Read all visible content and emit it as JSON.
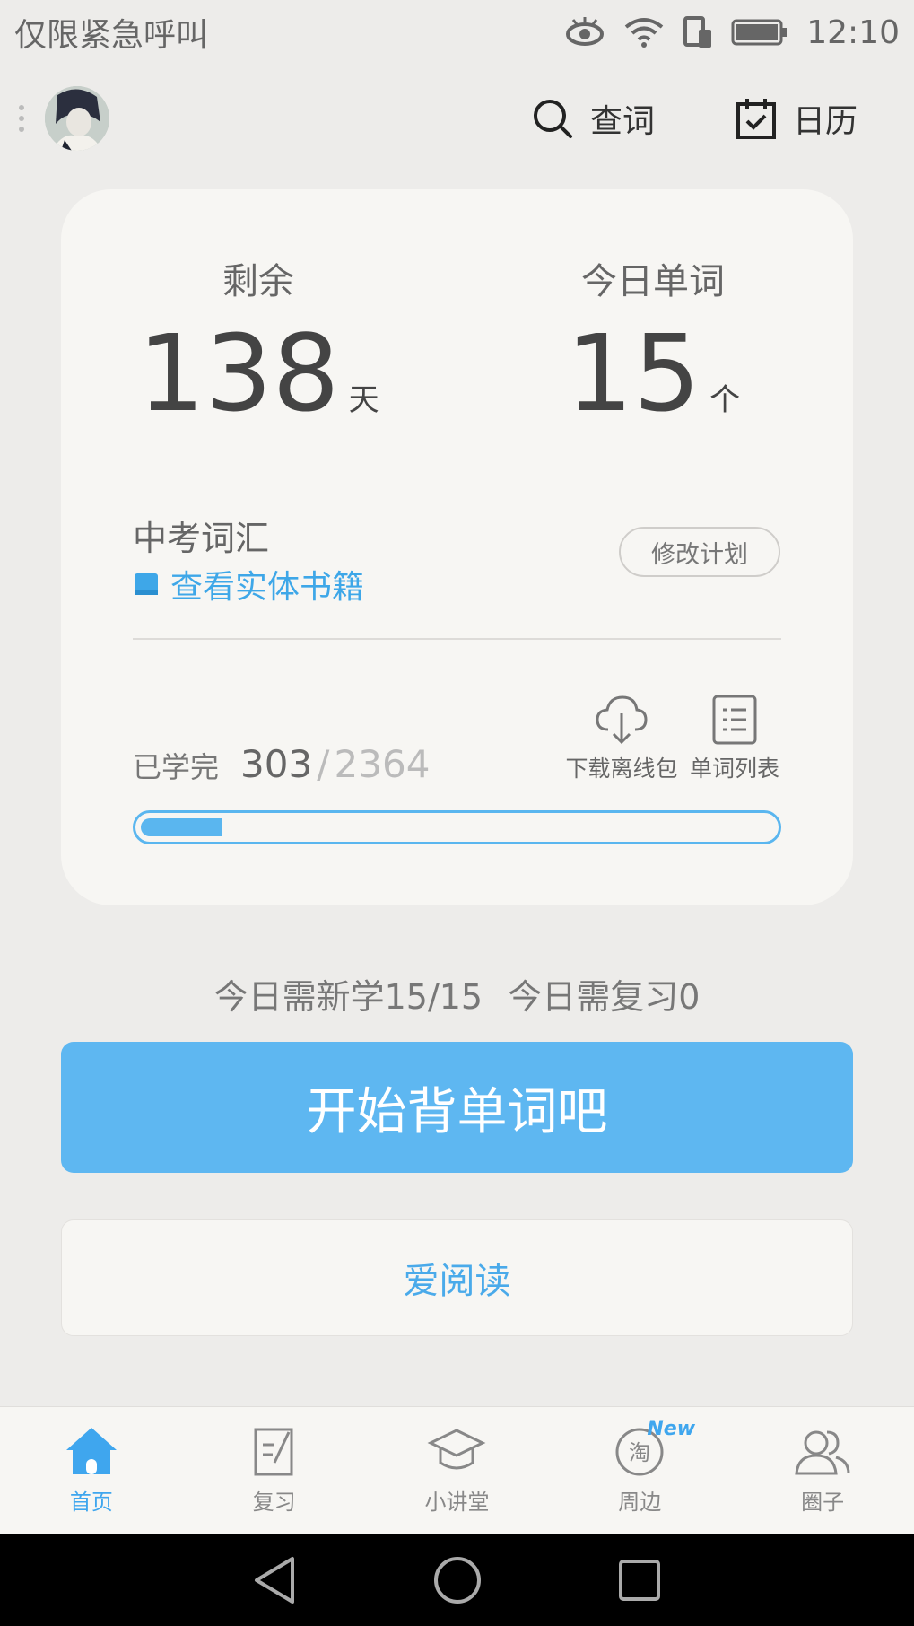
{
  "status_bar": {
    "carrier_text": "仅限紧急呼叫",
    "time": "12:10"
  },
  "header": {
    "search_label": "查词",
    "calendar_label": "日历"
  },
  "plan_card": {
    "remaining_label": "剩余",
    "remaining_value": "138",
    "remaining_unit": "天",
    "today_words_label": "今日单词",
    "today_words_value": "15",
    "today_words_unit": "个",
    "book_title": "中考词汇",
    "view_book_label": "查看实体书籍",
    "modify_plan_label": "修改计划",
    "learned_label": "已学完",
    "learned_count": "303",
    "separator": "/",
    "total_count": "2364",
    "download_label": "下载离线包",
    "word_list_label": "单词列表",
    "progress_fraction": 0.128
  },
  "today_summary": {
    "new_text": "今日需新学15/15",
    "review_text": "今日需复习0"
  },
  "buttons": {
    "start_label": "开始背单词吧",
    "read_label": "爱阅读"
  },
  "bottom_nav": {
    "items": [
      {
        "label": "首页",
        "icon": "home-icon",
        "active": true
      },
      {
        "label": "复习",
        "icon": "review-icon",
        "active": false
      },
      {
        "label": "小讲堂",
        "icon": "graduation-cap-icon",
        "active": false
      },
      {
        "label": "周边",
        "icon": "tao-icon",
        "active": false,
        "badge": "New"
      },
      {
        "label": "圈子",
        "icon": "people-icon",
        "active": false
      }
    ]
  },
  "colors": {
    "accent": "#5eb7f1",
    "background": "#edecea",
    "card": "#f7f6f3"
  }
}
